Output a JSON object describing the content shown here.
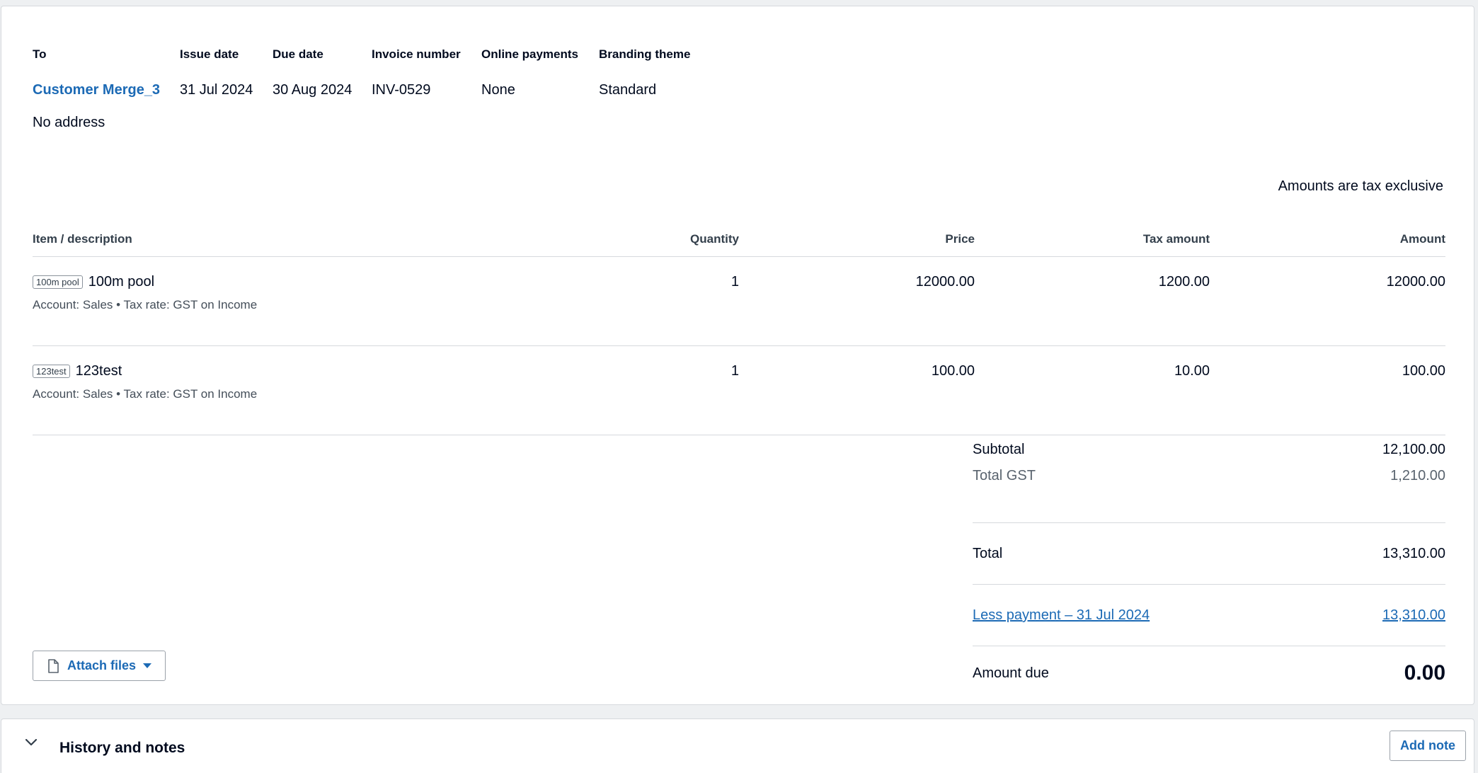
{
  "invoice": {
    "to_label": "To",
    "to_value": "Customer Merge_3",
    "issue_date_label": "Issue date",
    "issue_date": "31 Jul 2024",
    "due_date_label": "Due date",
    "due_date": "30 Aug 2024",
    "invoice_number_label": "Invoice number",
    "invoice_number": "INV-0529",
    "online_payments_label": "Online payments",
    "online_payments": "None",
    "branding_theme_label": "Branding theme",
    "branding_theme": "Standard",
    "address": "No address",
    "tax_note": "Amounts are tax exclusive"
  },
  "table": {
    "headers": {
      "item": "Item / description",
      "quantity": "Quantity",
      "price": "Price",
      "tax_amount": "Tax amount",
      "amount": "Amount"
    },
    "rows": [
      {
        "code": "100m pool",
        "name": "100m pool",
        "quantity": "1",
        "price": "12000.00",
        "tax_amount": "1200.00",
        "amount": "12000.00",
        "detail": "Account: Sales • Tax rate: GST on Income"
      },
      {
        "code": "123test",
        "name": "123test",
        "quantity": "1",
        "price": "100.00",
        "tax_amount": "10.00",
        "amount": "100.00",
        "detail": "Account: Sales • Tax rate: GST on Income"
      }
    ]
  },
  "totals": {
    "subtotal_label": "Subtotal",
    "subtotal": "12,100.00",
    "gst_label": "Total GST",
    "gst": "1,210.00",
    "total_label": "Total",
    "total": "13,310.00",
    "payment_label": "Less payment – 31 Jul 2024",
    "payment": "13,310.00",
    "amount_due_label": "Amount due",
    "amount_due": "0.00"
  },
  "actions": {
    "attach_files": "Attach files"
  },
  "history": {
    "title": "History and notes",
    "add_note": "Add note"
  },
  "colors": {
    "link": "#1c6ab5",
    "border": "#d6d9dd"
  }
}
